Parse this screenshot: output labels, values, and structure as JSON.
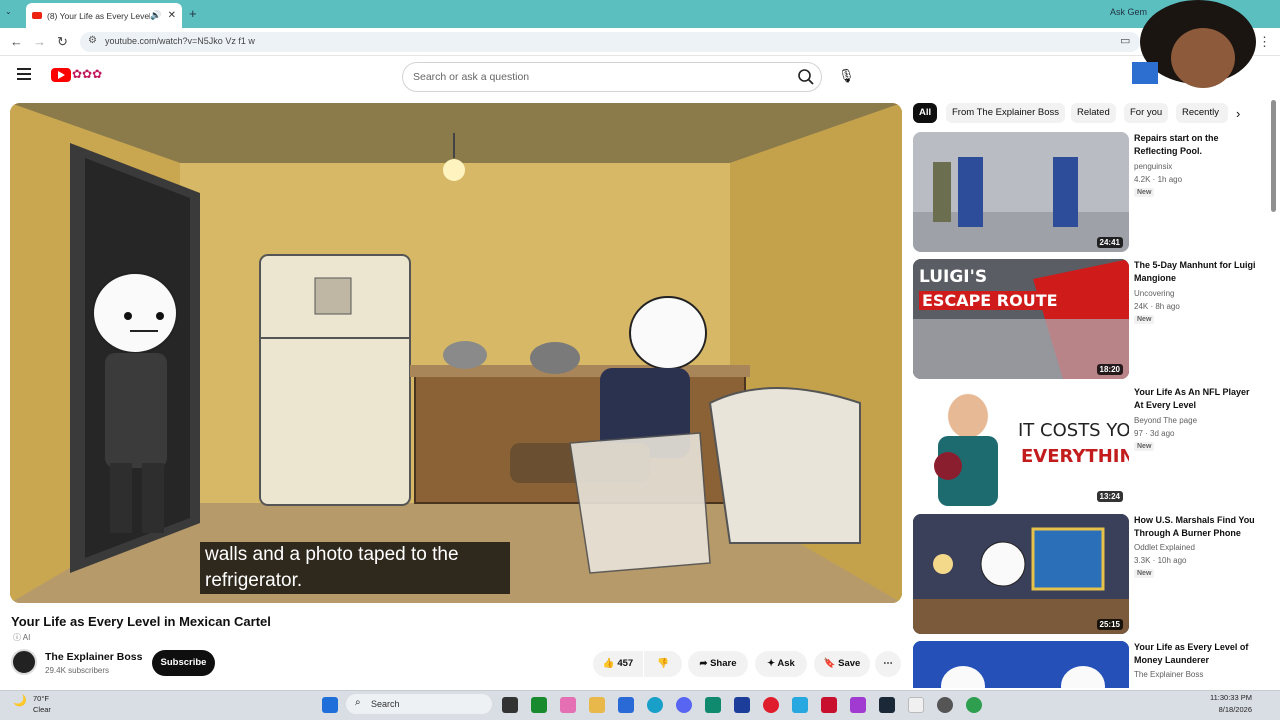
{
  "browser": {
    "tab_title": "(8) Your Life as Every Level in Mexican Cartel",
    "url": "youtube.com/watch?v=N5Jko Vz f1 w",
    "ask_gemini": "Ask Gem"
  },
  "youtube": {
    "search_placeholder": "Search or ask a question",
    "video": {
      "caption_line1": "walls and a photo taped to the",
      "caption_line2": "refrigerator.",
      "title": "Your Life as Every Level in Mexican Cartel",
      "ai_label": "AI",
      "channel": "The Explainer Boss",
      "subscribers": "29.4K subscribers",
      "subscribe_label": "Subscribe",
      "likes": "457",
      "share_label": "Share",
      "ask_label": "Ask",
      "save_label": "Save"
    },
    "chips": [
      "All",
      "From The Explainer Boss",
      "Related",
      "For you",
      "Recently"
    ],
    "recommendations": [
      {
        "title": "Repairs start on the Reflecting Pool.",
        "channel": "penguinsix",
        "meta": "4.2K · 1h ago",
        "badge": "New",
        "duration": "24:41"
      },
      {
        "title": "The 5-Day Manhunt for Luigi Mangione",
        "channel": "Uncovering",
        "meta": "24K · 8h ago",
        "badge": "New",
        "duration": "18:20",
        "thumb_text1": "LUIGI'S",
        "thumb_text2": "ESCAPE ROUTE"
      },
      {
        "title": "Your Life As An NFL Player At Every Level",
        "channel": "Beyond The page",
        "meta": "97 · 3d ago",
        "badge": "New",
        "duration": "13:24",
        "thumb_text1": "IT COSTS YOU",
        "thumb_text2": "EVERYTHING"
      },
      {
        "title": "How U.S. Marshals Find You Through A Burner Phone",
        "channel": "Oddlet Explained",
        "meta": "3.3K · 10h ago",
        "badge": "New",
        "duration": "25:15"
      },
      {
        "title": "Your Life as Every Level of Money Launderer",
        "channel": "The Explainer Boss",
        "meta": "",
        "badge": "",
        "duration": ""
      }
    ]
  },
  "taskbar": {
    "temperature": "70°F",
    "condition": "Clear",
    "search_label": "Search",
    "time": "11:30:33 PM",
    "date": "8/18/2026"
  }
}
